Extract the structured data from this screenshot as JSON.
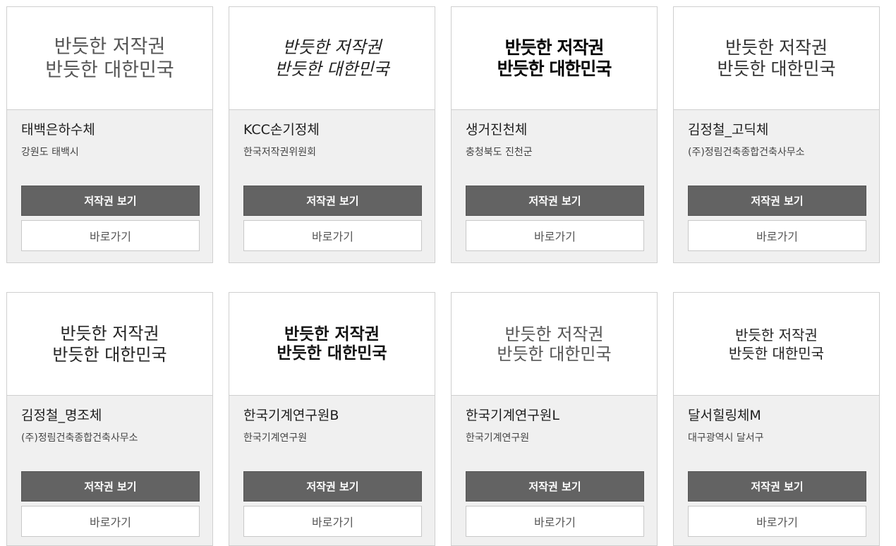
{
  "buttons": {
    "copyright_label": "저작권 보기",
    "go_label": "바로가기"
  },
  "fonts": [
    {
      "sample": "반듯한 저작권\n반듯한 대한민국",
      "name": "태백은하수체",
      "provider": "강원도 태백시"
    },
    {
      "sample": "반듯한 저작권\n반듯한 대한민국",
      "name": "KCC손기정체",
      "provider": "한국저작권위원회"
    },
    {
      "sample": "반듯한 저작권\n반듯한 대한민국",
      "name": "생거진천체",
      "provider": "충청북도 진천군"
    },
    {
      "sample": "반듯한 저작권\n반듯한 대한민국",
      "name": "김정철_고딕체",
      "provider": "(주)정림건축종합건축사무소"
    },
    {
      "sample": "반듯한 저작권\n반듯한 대한민국",
      "name": "김정철_명조체",
      "provider": "(주)정림건축종합건축사무소"
    },
    {
      "sample": "반듯한 저작권\n반듯한 대한민국",
      "name": "한국기계연구원B",
      "provider": "한국기계연구원"
    },
    {
      "sample": "반듯한 저작권\n반듯한 대한민국",
      "name": "한국기계연구원L",
      "provider": "한국기계연구원"
    },
    {
      "sample": "반듯한 저작권\n반듯한 대한민국",
      "name": "달서힐링체M",
      "provider": "대구광역시 달서구"
    }
  ]
}
